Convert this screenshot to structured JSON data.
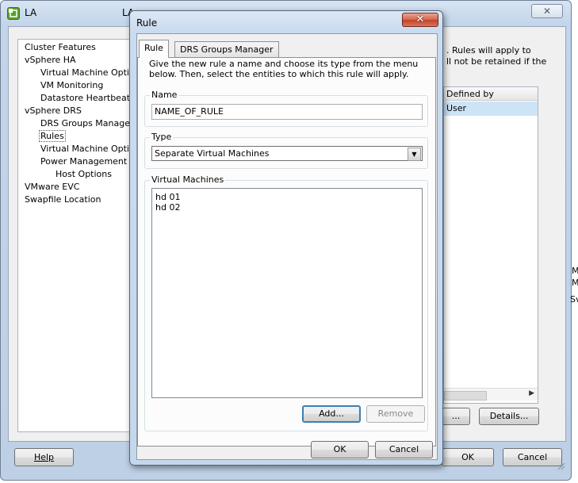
{
  "background_window": {
    "title_left": "LA",
    "title_right": "LA",
    "close_glyph": "✕",
    "tree": [
      {
        "label": "Cluster Features",
        "level": 0
      },
      {
        "label": "vSphere HA",
        "level": 0
      },
      {
        "label": "Virtual Machine Options",
        "level": 1
      },
      {
        "label": "VM Monitoring",
        "level": 1
      },
      {
        "label": "Datastore Heartbeating",
        "level": 1
      },
      {
        "label": "vSphere DRS",
        "level": 0
      },
      {
        "label": "DRS Groups Manager",
        "level": 1
      },
      {
        "label": "Rules",
        "level": 1,
        "selected": true
      },
      {
        "label": "Virtual Machine Options",
        "level": 1
      },
      {
        "label": "Power Management",
        "level": 1
      },
      {
        "label": "Host Options",
        "level": 2
      },
      {
        "label": "VMware EVC",
        "level": 0
      },
      {
        "label": "Swapfile Location",
        "level": 0
      }
    ],
    "description_line1": ". Rules will apply to",
    "description_line2": "ll not be retained if the",
    "table": {
      "column_header": "Defined by",
      "rows": [
        "User"
      ]
    },
    "details_button": "Details...",
    "partial_button": "...",
    "help_button": "Help",
    "ok_button": "OK",
    "cancel_button": "Cancel",
    "edge_fragments": [
      "M",
      "M",
      "Sv"
    ]
  },
  "dialog": {
    "title": "Rule",
    "close_glyph": "✕",
    "tabs": [
      {
        "label": "Rule",
        "active": true
      },
      {
        "label": "DRS Groups Manager",
        "active": false
      }
    ],
    "instructions": "Give the new rule a name and choose its type from the menu below. Then, select the entities to which this rule will apply.",
    "name_group": {
      "label": "Name",
      "value": "NAME_OF_RULE"
    },
    "type_group": {
      "label": "Type",
      "selected": "Separate Virtual Machines"
    },
    "vm_group": {
      "label": "Virtual Machines",
      "items": [
        "hd 01",
        "hd 02"
      ],
      "add_button": "Add...",
      "remove_button": "Remove"
    },
    "ok_button": "OK",
    "cancel_button": "Cancel"
  },
  "colors": {
    "selection_blue": "#cde4f7",
    "close_red": "#c2412a",
    "window_frame": "#c3d5ea"
  }
}
